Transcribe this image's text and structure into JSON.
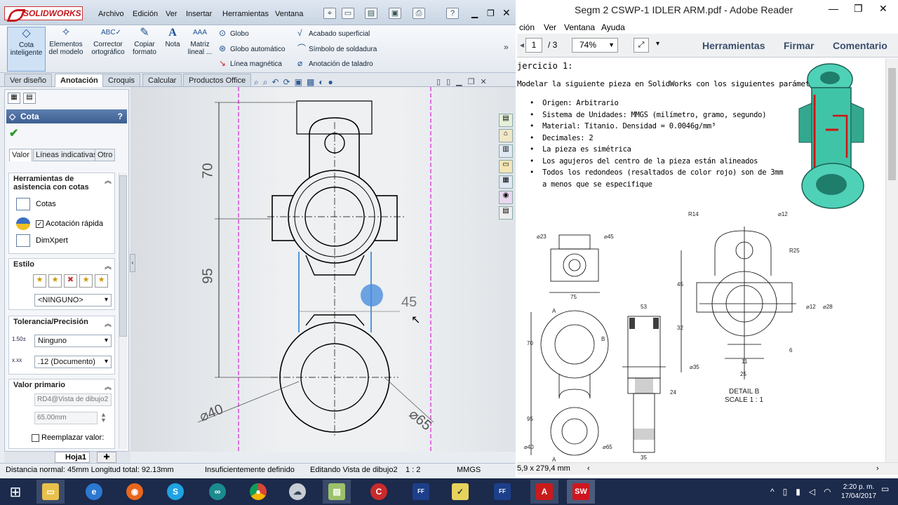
{
  "sw": {
    "logo": "SOLIDWORKS",
    "menu": [
      "Archivo",
      "Edición",
      "Ver",
      "Insertar",
      "Herramientas",
      "Ventana"
    ],
    "ribbon_big": [
      {
        "label": "Cota inteligente",
        "icon": "smart-dimension-icon"
      },
      {
        "label": "Elementos del modelo",
        "icon": "model-items-icon"
      },
      {
        "label": "Corrector ortográfico",
        "icon": "spell-check-icon"
      },
      {
        "label": "Copiar formato",
        "icon": "format-painter-icon"
      },
      {
        "label": "Nota",
        "icon": "note-icon"
      },
      {
        "label": "Matriz lineal ...",
        "icon": "linear-pattern-icon"
      }
    ],
    "ribbon_small_col1": [
      "Globo",
      "Globo automático",
      "Línea magnética"
    ],
    "ribbon_small_col2": [
      "Acabado superficial",
      "Símbolo de soldadura",
      "Anotación de taladro"
    ],
    "tabs": [
      "Ver diseño",
      "Anotación",
      "Croquis",
      "Calcular",
      "Productos Office"
    ],
    "pm_title": "Cota",
    "pm_tabs": [
      "Valor",
      "Líneas indicativas",
      "Otro"
    ],
    "assist_title": "Herramientas de asistencia con cotas",
    "assist_items": [
      "Cotas",
      "Acotación rápida",
      "DimXpert"
    ],
    "estilo_title": "Estilo",
    "estilo_value": "<NINGUNO>",
    "tol_title": "Tolerancia/Precisión",
    "tol_value": "Ninguno",
    "precision_value": ".12 (Documento)",
    "valor_title": "Valor primario",
    "valor_ref": "RD4@Vista de dibujo2",
    "valor_mm": "65.00mm",
    "reemplazar": "Reemplazar valor:",
    "sheet_tab": "Hoja1",
    "dims": {
      "d70": "70",
      "d95": "95",
      "d45": "45",
      "d40": "⌀40",
      "d65": "⌀65"
    },
    "status": [
      "Distancia normal: 45mm Longitud total: 92.13mm",
      "Insuficientemente definido",
      "Editando Vista de dibujo2",
      "1 : 2",
      "MMGS"
    ]
  },
  "ar": {
    "title": "Segm 2 CSWP-1 IDLER ARM.pdf - Adobe Reader",
    "menu": [
      "ción",
      "Ver",
      "Ventana",
      "Ayuda"
    ],
    "page": "1",
    "pages": "/ 3",
    "zoom": "74%",
    "tools": [
      "Herramientas",
      "Firmar",
      "Comentario"
    ],
    "heading": "jercicio 1:",
    "intro": "Modelar la siguiente pieza en SolidWorks con los siguientes parámetros:",
    "bullets": [
      "Origen: Arbitrario",
      "Sistema de Unidades: MMGS (milímetro, gramo, segundo)",
      "Material: Titanio. Densidad = 0.0046g/mm³",
      "Decimales: 2",
      "La pieza es simétrica",
      "Los agujeros del centro de la pieza están alineados",
      "Todos los redondeos (resaltados de color rojo) son de 3mm a menos que se especifique"
    ],
    "detail_label": "DETAIL B",
    "scale_label": "SCALE 1 : 1",
    "page_size": "5,9 x 279,4 mm",
    "labels": {
      "l23": "⌀23",
      "l45": "⌀45",
      "l75": "75",
      "l70": "70",
      "l95": "95",
      "l40": "⌀40",
      "l65": "⌀65",
      "l53": "53",
      "l24": "24",
      "l35": "35",
      "r14": "R14",
      "d12": "⌀12",
      "r25": "R25",
      "d45": "45",
      "d12b": "⌀12",
      "d28": "⌀28",
      "d32": "32",
      "d6": "6",
      "d11": "11",
      "d25": "25",
      "d35": "⌀35",
      "la": "A",
      "lb": "B",
      "la2": "A"
    }
  },
  "task": {
    "time": "2:20 p. m.",
    "date": "17/04/2017"
  }
}
